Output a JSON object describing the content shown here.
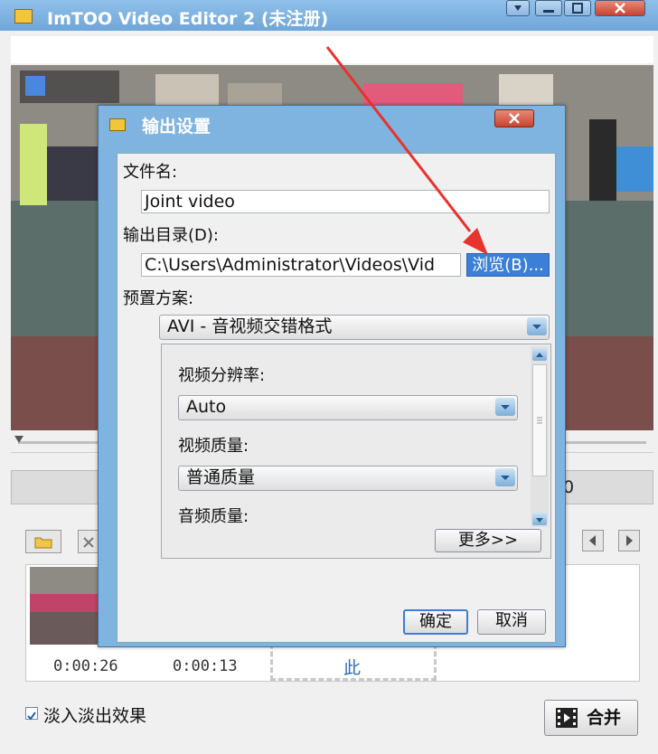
{
  "main_window": {
    "title": "ImTOO Video Editor 2 (未注册)",
    "time_right": "0",
    "clips": [
      {
        "time": "0:00:26"
      },
      {
        "time": "0:00:13"
      }
    ],
    "drop_zone_text": "此",
    "fade_checkbox_label": "淡入淡出效果",
    "fade_checked": true,
    "merge_label": "合并"
  },
  "dialog": {
    "title": "输出设置",
    "filename_label": "文件名:",
    "filename_value": "Joint video",
    "outdir_label": "输出目录(D):",
    "outdir_value": "C:\\Users\\Administrator\\Videos\\Vid",
    "browse_label": "浏览(B)...",
    "preset_label": "预置方案:",
    "preset_value": "AVI - 音视频交错格式",
    "resolution_label": "视频分辨率:",
    "resolution_value": "Auto",
    "video_quality_label": "视频质量:",
    "video_quality_value": "普通质量",
    "audio_quality_label": "音频质量:",
    "more_label": "更多>>",
    "ok_label": "确定",
    "cancel_label": "取消"
  },
  "colors": {
    "title_bar": "#7fb3e0",
    "accent_blue": "#3b7fd6",
    "annotation_arrow": "#e8322e"
  }
}
